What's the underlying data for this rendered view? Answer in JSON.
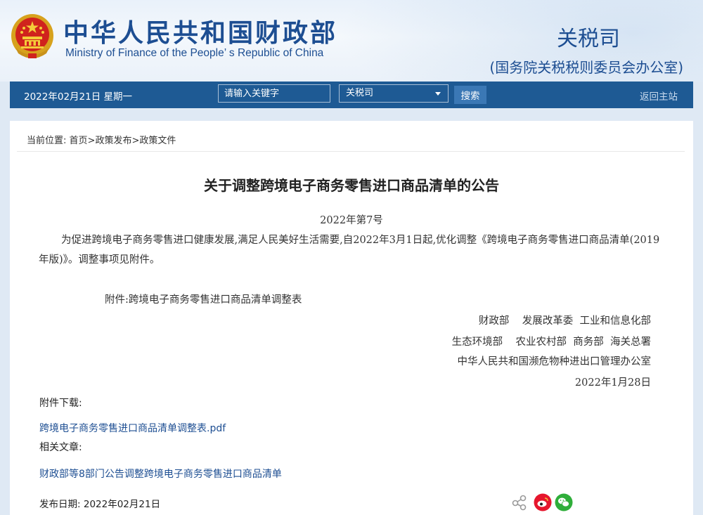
{
  "header": {
    "site_title_cn": "中华人民共和国财政部",
    "site_title_en": "Ministry of Finance of the People’ s Republic of China",
    "department": "关税司",
    "department_sub": "(国务院关税税则委员会办公室)"
  },
  "navbar": {
    "date_text": "2022年02月21日   星期一",
    "search_placeholder": "请输入关键字",
    "search_value": "",
    "category_selected": "关税司",
    "search_button": "搜索",
    "home_link": "返回主站"
  },
  "breadcrumb": {
    "prefix": "当前位置:",
    "items": [
      "首页",
      "政策发布",
      "政策文件"
    ],
    "separator": ">"
  },
  "article": {
    "title": "关于调整跨境电子商务零售进口商品清单的公告",
    "doc_number": "2022年第7号",
    "body": "为促进跨境电子商务零售进口健康发展,满足人民美好生活需要,自2022年3月1日起,优化调整《跨境电子商务零售进口商品清单(2019年版)》。调整事项见附件。",
    "attachment_note": "附件:跨境电子商务零售进口商品清单调整表",
    "signatories": [
      "财政部    发展改革委  工业和信息化部",
      "生态环境部    农业农村部  商务部  海关总署",
      "中华人民共和国濒危物种进出口管理办公室"
    ],
    "date": "2022年1月28日"
  },
  "downloads": {
    "label": "附件下载:",
    "file": "跨境电子商务零售进口商品清单调整表.pdf"
  },
  "related": {
    "label": "相关文章:",
    "article": "财政部等8部门公告调整跨境电子商务零售进口商品清单"
  },
  "footer": {
    "publish_label": "发布日期:",
    "publish_date": "2022年02月21日"
  },
  "icons": {
    "emblem": "national-emblem-icon",
    "share": "share-icon",
    "weibo": "weibo-icon",
    "wechat": "wechat-icon"
  },
  "colors": {
    "brand_blue": "#1d4e92",
    "nav_bar": "#1e5a94",
    "weibo_red": "#e6162d",
    "wechat_green": "#2fae3a"
  }
}
